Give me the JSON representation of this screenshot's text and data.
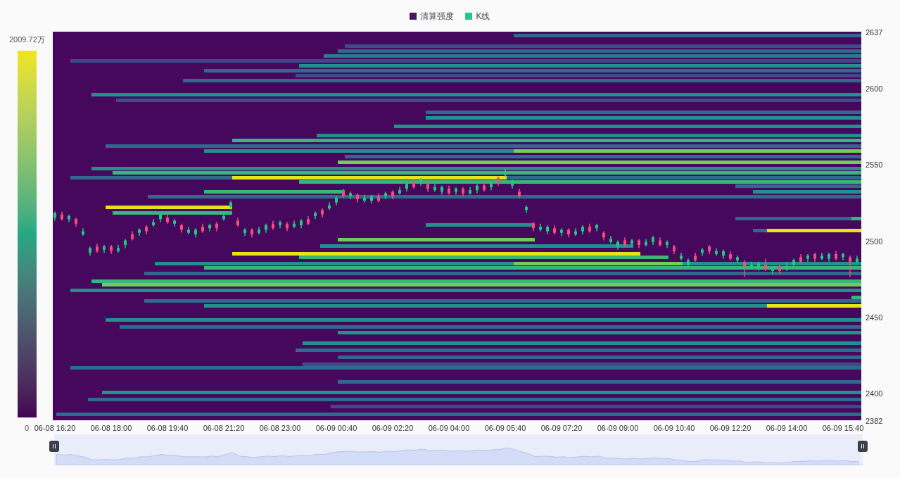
{
  "legend": [
    {
      "label": "清算强度",
      "color": "#4a1460"
    },
    {
      "label": "K线",
      "color": "#22c883"
    }
  ],
  "color_scale": {
    "max_label": "2009.72万",
    "min_label": "0"
  },
  "chart_data": {
    "type": "candlestick",
    "ylim": [
      2382,
      2637
    ],
    "yticks": [
      {
        "value": 2637,
        "label": "2637"
      },
      {
        "value": 2600,
        "label": "2600"
      },
      {
        "value": 2550,
        "label": "2550"
      },
      {
        "value": 2500,
        "label": "2500"
      },
      {
        "value": 2450,
        "label": "2450"
      },
      {
        "value": 2400,
        "label": "2400"
      },
      {
        "value": 2382,
        "label": "2382"
      }
    ],
    "categories": [
      "06-08 16:20",
      null,
      null,
      null,
      null,
      null,
      null,
      null,
      "06-08 18:00",
      null,
      null,
      null,
      null,
      null,
      null,
      null,
      "06-08 19:40",
      null,
      null,
      null,
      null,
      null,
      null,
      null,
      "06-08 21:20",
      null,
      null,
      null,
      null,
      null,
      null,
      null,
      "06-08 23:00",
      null,
      null,
      null,
      null,
      null,
      null,
      null,
      "06-09 00:40",
      null,
      null,
      null,
      null,
      null,
      null,
      null,
      "06-09 02:20",
      null,
      null,
      null,
      null,
      null,
      null,
      null,
      "06-09 04:00",
      null,
      null,
      null,
      null,
      null,
      null,
      null,
      "06-09 05:40",
      null,
      null,
      null,
      null,
      null,
      null,
      null,
      "06-09 07:20",
      null,
      null,
      null,
      null,
      null,
      null,
      null,
      "06-09 09:00",
      null,
      null,
      null,
      null,
      null,
      null,
      null,
      "06-09 10:40",
      null,
      null,
      null,
      null,
      null,
      null,
      null,
      "06-09 12:20",
      null,
      null,
      null,
      null,
      null,
      null,
      null,
      "06-09 14:00",
      null,
      null,
      null,
      null,
      null,
      null,
      null,
      "06-09 15:40",
      null,
      null
    ],
    "ohlc": [
      [
        2515,
        2519,
        2513,
        2518
      ],
      [
        2517,
        2519,
        2513,
        2514
      ],
      [
        2514,
        2517,
        2512,
        2516
      ],
      [
        2514,
        2515,
        2509,
        2511
      ],
      [
        2504,
        2508,
        2503,
        2506
      ],
      [
        2492,
        2496,
        2490,
        2495
      ],
      [
        2496,
        2498,
        2492,
        2493
      ],
      [
        2494,
        2497,
        2492,
        2496
      ],
      [
        2496,
        2497,
        2491,
        2493
      ],
      [
        2493,
        2497,
        2492,
        2495
      ],
      [
        2497,
        2501,
        2495,
        2500
      ],
      [
        2504,
        2506,
        2500,
        2501
      ],
      [
        2505,
        2508,
        2503,
        2507
      ],
      [
        2509,
        2510,
        2504,
        2506
      ],
      [
        2510,
        2514,
        2509,
        2512
      ],
      [
        2514,
        2518,
        2512,
        2517
      ],
      [
        2515,
        2517,
        2511,
        2512
      ],
      [
        2511,
        2514,
        2509,
        2513
      ],
      [
        2510,
        2511,
        2505,
        2507
      ],
      [
        2505,
        2509,
        2504,
        2507
      ],
      [
        2504,
        2508,
        2502,
        2507
      ],
      [
        2509,
        2511,
        2505,
        2506
      ],
      [
        2508,
        2511,
        2506,
        2510
      ],
      [
        2511,
        2512,
        2506,
        2508
      ],
      [
        2514,
        2518,
        2513,
        2516
      ],
      [
        2522,
        2526,
        2520,
        2525
      ],
      [
        2513,
        2515,
        2509,
        2510
      ],
      [
        2505,
        2508,
        2503,
        2507
      ],
      [
        2507,
        2508,
        2502,
        2504
      ],
      [
        2505,
        2509,
        2504,
        2507
      ],
      [
        2507,
        2511,
        2505,
        2510
      ],
      [
        2511,
        2513,
        2507,
        2508
      ],
      [
        2510,
        2513,
        2508,
        2512
      ],
      [
        2511,
        2512,
        2506,
        2508
      ],
      [
        2509,
        2513,
        2508,
        2511
      ],
      [
        2510,
        2514,
        2508,
        2513
      ],
      [
        2514,
        2516,
        2510,
        2511
      ],
      [
        2516,
        2519,
        2514,
        2518
      ],
      [
        2520,
        2521,
        2515,
        2517
      ],
      [
        2521,
        2525,
        2520,
        2523
      ],
      [
        2525,
        2529,
        2523,
        2528
      ],
      [
        2532,
        2534,
        2528,
        2529
      ],
      [
        2529,
        2532,
        2527,
        2531
      ],
      [
        2530,
        2531,
        2525,
        2527
      ],
      [
        2526,
        2530,
        2525,
        2528
      ],
      [
        2526,
        2530,
        2524,
        2529
      ],
      [
        2529,
        2531,
        2525,
        2526
      ],
      [
        2529,
        2532,
        2527,
        2531
      ],
      [
        2532,
        2533,
        2527,
        2529
      ],
      [
        2531,
        2535,
        2530,
        2533
      ],
      [
        2534,
        2538,
        2532,
        2537
      ],
      [
        2538,
        2540,
        2534,
        2535
      ],
      [
        2538,
        2541,
        2536,
        2540
      ],
      [
        2537,
        2538,
        2532,
        2534
      ],
      [
        2533,
        2537,
        2532,
        2535
      ],
      [
        2532,
        2536,
        2530,
        2535
      ],
      [
        2534,
        2536,
        2530,
        2531
      ],
      [
        2532,
        2535,
        2530,
        2534
      ],
      [
        2534,
        2535,
        2529,
        2531
      ],
      [
        2531,
        2535,
        2530,
        2533
      ],
      [
        2533,
        2537,
        2531,
        2536
      ],
      [
        2536,
        2538,
        2532,
        2533
      ],
      [
        2535,
        2538,
        2533,
        2537
      ],
      [
        2541,
        2542,
        2536,
        2538
      ],
      [
        2543,
        2547,
        2542,
        2545
      ],
      [
        2536,
        2540,
        2534,
        2539
      ],
      [
        2532,
        2534,
        2528,
        2529
      ],
      [
        2520,
        2523,
        2518,
        2522
      ],
      [
        2511,
        2512,
        2506,
        2508
      ],
      [
        2507,
        2511,
        2506,
        2509
      ],
      [
        2506,
        2510,
        2504,
        2509
      ],
      [
        2508,
        2510,
        2504,
        2505
      ],
      [
        2505,
        2508,
        2503,
        2507
      ],
      [
        2507,
        2508,
        2502,
        2504
      ],
      [
        2504,
        2508,
        2503,
        2506
      ],
      [
        2506,
        2510,
        2504,
        2509
      ],
      [
        2509,
        2511,
        2505,
        2506
      ],
      [
        2508,
        2511,
        2506,
        2510
      ],
      [
        2505,
        2506,
        2500,
        2502
      ],
      [
        2499,
        2503,
        2498,
        2501
      ],
      [
        2496,
        2500,
        2494,
        2499
      ],
      [
        2500,
        2502,
        2496,
        2497
      ],
      [
        2498,
        2501,
        2496,
        2500
      ],
      [
        2500,
        2501,
        2495,
        2497
      ],
      [
        2497,
        2501,
        2496,
        2499
      ],
      [
        2499,
        2503,
        2497,
        2502
      ],
      [
        2500,
        2502,
        2496,
        2497
      ],
      [
        2497,
        2500,
        2495,
        2499
      ],
      [
        2496,
        2497,
        2491,
        2493
      ],
      [
        2488,
        2492,
        2487,
        2490
      ],
      [
        2484,
        2488,
        2482,
        2487
      ],
      [
        2490,
        2492,
        2486,
        2487
      ],
      [
        2492,
        2495,
        2490,
        2494
      ],
      [
        2496,
        2497,
        2491,
        2493
      ],
      [
        2491,
        2495,
        2490,
        2493
      ],
      [
        2490,
        2494,
        2488,
        2493
      ],
      [
        2491,
        2493,
        2487,
        2488
      ],
      [
        2487,
        2490,
        2485,
        2489
      ],
      [
        2486,
        2487,
        2476,
        2483
      ],
      [
        2482,
        2486,
        2481,
        2484
      ],
      [
        2482,
        2486,
        2480,
        2485
      ],
      [
        2484,
        2488,
        2480,
        2481
      ],
      [
        2480,
        2483,
        2478,
        2482
      ],
      [
        2483,
        2484,
        2478,
        2480
      ],
      [
        2481,
        2485,
        2480,
        2483
      ],
      [
        2484,
        2488,
        2482,
        2487
      ],
      [
        2489,
        2491,
        2485,
        2486
      ],
      [
        2488,
        2491,
        2486,
        2490
      ],
      [
        2491,
        2492,
        2486,
        2488
      ],
      [
        2488,
        2492,
        2487,
        2490
      ],
      [
        2488,
        2492,
        2486,
        2491
      ],
      [
        2491,
        2493,
        2487,
        2488
      ],
      [
        2489,
        2492,
        2487,
        2491
      ],
      [
        2489,
        2490,
        2476,
        2486
      ],
      [
        2486,
        2490,
        2485,
        2488
      ]
    ]
  },
  "zoom_slider": {
    "level": 1
  }
}
